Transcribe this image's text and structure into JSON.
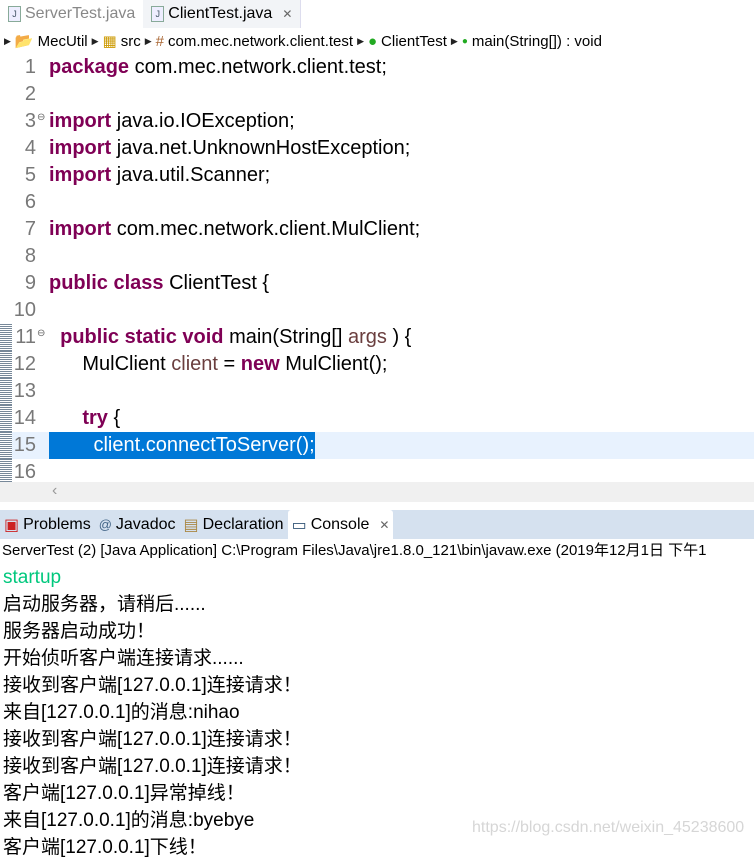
{
  "editor_tabs": [
    {
      "label": "ServerTest.java",
      "active": false
    },
    {
      "label": "ClientTest.java",
      "active": true
    }
  ],
  "breadcrumb": [
    "MecUtil",
    "src",
    "com.mec.network.client.test",
    "ClientTest",
    "main(String[]) : void"
  ],
  "code_lines": [
    [
      [
        "k",
        "package"
      ],
      [
        "",
        "com.mec.network.client.test;"
      ]
    ],
    [],
    [
      [
        "k",
        "import"
      ],
      [
        "",
        "java.io.IOException;"
      ]
    ],
    [
      [
        "k",
        "import"
      ],
      [
        "",
        "java.net.UnknownHostException;"
      ]
    ],
    [
      [
        "k",
        "import"
      ],
      [
        "",
        "java.util.Scanner;"
      ]
    ],
    [],
    [
      [
        "k",
        "import"
      ],
      [
        "",
        "com.mec.network.client.MulClient;"
      ]
    ],
    [],
    [
      [
        "k",
        "public"
      ],
      [
        "k",
        "class"
      ],
      [
        "",
        "ClientTest {"
      ]
    ],
    [],
    [
      [
        "",
        "  "
      ],
      [
        "k",
        "public"
      ],
      [
        "k",
        "static"
      ],
      [
        "k",
        "void"
      ],
      [
        "",
        "main(String[]"
      ],
      [
        "v",
        "args"
      ],
      [
        "",
        ") {"
      ]
    ],
    [
      [
        "",
        "      MulClient"
      ],
      [
        "v",
        "client"
      ],
      [
        "",
        "="
      ],
      [
        "k",
        "new"
      ],
      [
        "",
        "MulClient();"
      ]
    ],
    [],
    [
      [
        "",
        "      "
      ],
      [
        "k",
        "try"
      ],
      [
        "",
        "{"
      ]
    ],
    [
      [
        "",
        "        client.connectToServer();"
      ]
    ],
    []
  ],
  "highlight_line": 15,
  "colors": {
    "keyword": "#7f0055",
    "variable": "#6a3e3e",
    "selection": "#0078d7",
    "console_system": "#00c87d"
  },
  "panel_tabs": [
    {
      "label": "Problems",
      "icon": "problems-icon"
    },
    {
      "label": "Javadoc",
      "icon": "at-icon"
    },
    {
      "label": "Declaration",
      "icon": "declaration-icon"
    },
    {
      "label": "Console",
      "icon": "console-icon",
      "active": true
    }
  ],
  "console_info": "ServerTest (2) [Java Application] C:\\Program Files\\Java\\jre1.8.0_121\\bin\\javaw.exe (2019年12月1日 下午1",
  "console_lines": [
    "startup",
    "启动服务器，请稍后......",
    "服务器启动成功！",
    "开始侦听客户端连接请求......",
    "接收到客户端[127.0.0.1]连接请求！",
    "来自[127.0.0.1]的消息:nihao",
    "接收到客户端[127.0.0.1]连接请求！",
    "接收到客户端[127.0.0.1]连接请求！",
    "客户端[127.0.0.1]异常掉线！",
    "来自[127.0.0.1]的消息:byebye",
    "客户端[127.0.0.1]下线！"
  ],
  "watermark": "https://blog.csdn.net/weixin_45238600"
}
